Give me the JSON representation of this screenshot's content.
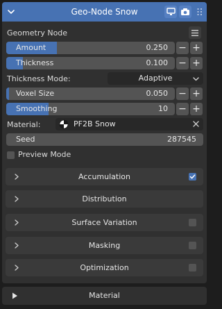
{
  "header": {
    "title": "Geo-Node Snow"
  },
  "node_label": "Geometry Node",
  "fields": {
    "amount": {
      "label": "Amount",
      "value": "0.250",
      "fill": 0.25
    },
    "thickness": {
      "label": "Thickness",
      "value": "0.100",
      "fill": 0.1
    }
  },
  "thickness_mode": {
    "label": "Thickness Mode:",
    "value": "Adaptive"
  },
  "voxel_size": {
    "label": "Voxel Size",
    "value": "0.050",
    "fill": 0.05
  },
  "smoothing": {
    "label": "Smoothing",
    "value": "10",
    "fill": 0.22
  },
  "material": {
    "label": "Material:",
    "value": "PF2B Snow"
  },
  "seed": {
    "label": "Seed",
    "value": "287545"
  },
  "preview_mode": {
    "label": "Preview Mode",
    "checked": false
  },
  "subpanels": [
    {
      "title": "Accumulation",
      "checkbox": true,
      "checked": true
    },
    {
      "title": "Distribution",
      "checkbox": false,
      "checked": false
    },
    {
      "title": "Surface Variation",
      "checkbox": true,
      "checked": false
    },
    {
      "title": "Masking",
      "checkbox": true,
      "checked": false
    },
    {
      "title": "Optimization",
      "checkbox": true,
      "checked": false
    }
  ],
  "bottom_panel": {
    "title": "Material"
  },
  "colors": {
    "accent": "#4772b3",
    "panel": "#303030",
    "field": "#545454",
    "background": "#1d1d1d"
  }
}
